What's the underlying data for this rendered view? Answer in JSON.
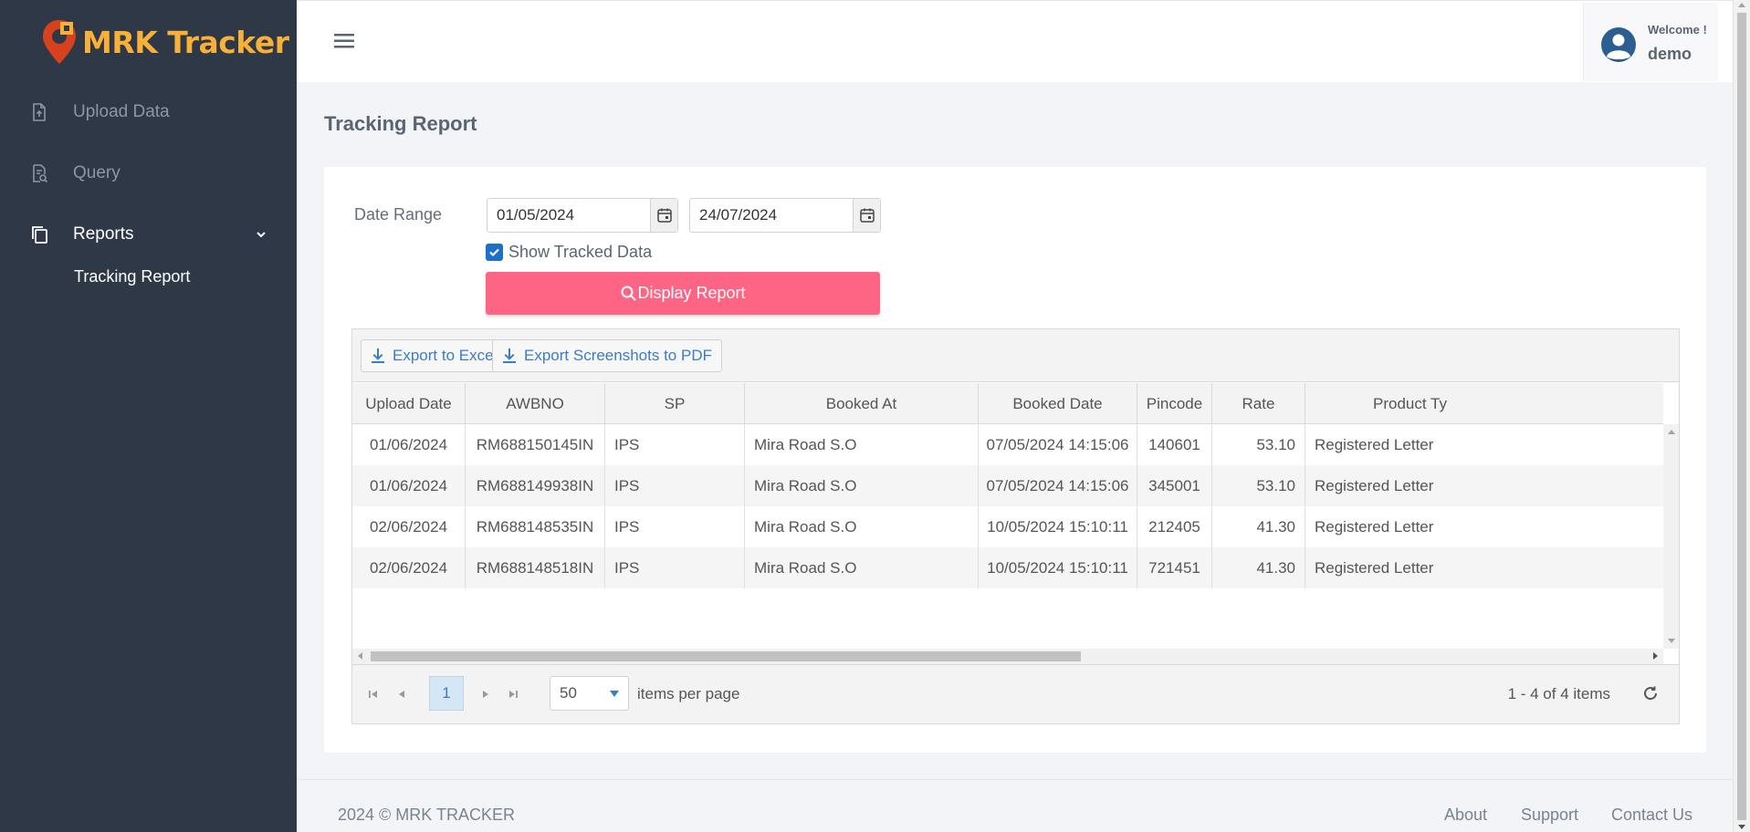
{
  "app": {
    "name": "MRK Tracker"
  },
  "sidebar": {
    "items": [
      {
        "label": "Upload Data"
      },
      {
        "label": "Query"
      },
      {
        "label": "Reports"
      }
    ],
    "subitems": [
      {
        "label": "Tracking Report"
      }
    ]
  },
  "header": {
    "welcome": "Welcome !",
    "username": "demo"
  },
  "page": {
    "title": "Tracking Report"
  },
  "form": {
    "date_range_label": "Date Range",
    "from_date": "01/05/2024",
    "to_date": "24/07/2024",
    "show_tracked_label": "Show Tracked Data",
    "show_tracked_checked": true,
    "display_button": "Display Report"
  },
  "grid": {
    "toolbar": {
      "export_excel": "Export to Excel",
      "export_pdf": "Export Screenshots to PDF"
    },
    "columns": [
      "Upload Date",
      "AWBNO",
      "SP",
      "Booked At",
      "Booked Date",
      "Pincode",
      "Rate",
      "Product Ty"
    ],
    "rows": [
      [
        "01/06/2024",
        "RM688150145IN",
        "IPS",
        "Mira Road S.O",
        "07/05/2024 14:15:06",
        "140601",
        "53.10",
        "Registered Letter"
      ],
      [
        "01/06/2024",
        "RM688149938IN",
        "IPS",
        "Mira Road S.O",
        "07/05/2024 14:15:06",
        "345001",
        "53.10",
        "Registered Letter"
      ],
      [
        "02/06/2024",
        "RM688148535IN",
        "IPS",
        "Mira Road S.O",
        "10/05/2024 15:10:11",
        "212405",
        "41.30",
        "Registered Letter"
      ],
      [
        "02/06/2024",
        "RM688148518IN",
        "IPS",
        "Mira Road S.O",
        "10/05/2024 15:10:11",
        "721451",
        "41.30",
        "Registered Letter"
      ]
    ],
    "pager": {
      "current_page": "1",
      "page_size": "50",
      "items_per_page_label": "items per page",
      "info": "1 - 4 of 4 items"
    }
  },
  "footer": {
    "copyright": "2024 © MRK TRACKER",
    "links": [
      "About",
      "Support",
      "Contact Us"
    ]
  },
  "colors": {
    "sidebar": "#2f3846",
    "accent": "#fe6585",
    "link": "#3b7dc5",
    "logo": "#f7b13a"
  },
  "icons": [
    "map-pin-icon",
    "file-upload-icon",
    "file-search-icon",
    "copy-icon",
    "chevron-down-icon",
    "hamburger-icon",
    "user-avatar-icon",
    "calendar-icon",
    "search-icon",
    "download-icon",
    "refresh-icon"
  ]
}
